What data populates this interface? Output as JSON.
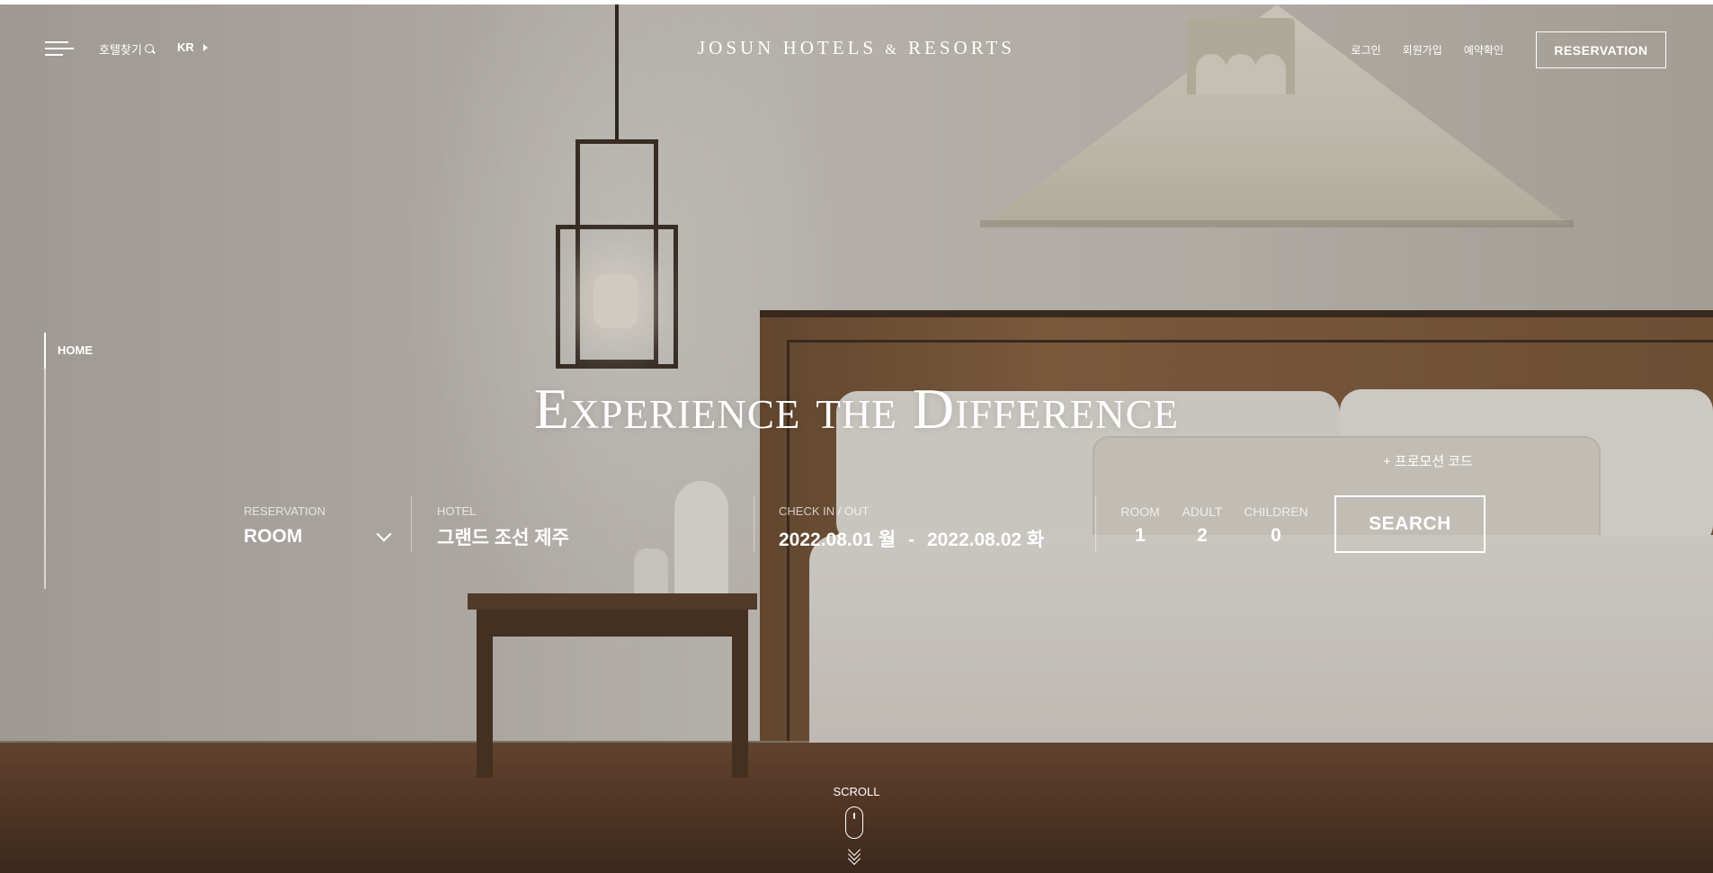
{
  "header": {
    "find_hotel_label": "호텔찾기",
    "language": "KR",
    "logo_main": "JOSUN HOTELS",
    "logo_amp": "&",
    "logo_tail": "RESORTS",
    "links": {
      "login": "로그인",
      "signup": "회원가입",
      "check_reservation": "예약확인"
    },
    "reservation_button": "RESERVATION"
  },
  "side_nav": {
    "active_item": "HOME"
  },
  "hero": {
    "title": "Experience the Difference"
  },
  "booking": {
    "promo_label": "+ 프로모션 코드",
    "reservation_type": {
      "label": "RESERVATION",
      "value": "ROOM"
    },
    "hotel": {
      "label": "HOTEL",
      "value": "그랜드 조선 제주"
    },
    "dates": {
      "label": "CHECK IN / OUT",
      "check_in": "2022.08.01 월",
      "separator": "-",
      "check_out": "2022.08.02 화"
    },
    "room": {
      "label": "ROOM",
      "value": "1"
    },
    "adult": {
      "label": "ADULT",
      "value": "2"
    },
    "children": {
      "label": "CHILDREN",
      "value": "0"
    },
    "search_button": "SEARCH"
  },
  "scroll": {
    "label": "SCROLL"
  },
  "icons": [
    "menu-icon",
    "search-icon",
    "caret-right-icon",
    "chevron-down-icon",
    "mouse-icon",
    "chevrons-down-icon"
  ],
  "colors": {
    "text": "#ffffff",
    "wood": "#7a573a",
    "wall": "#c9c4be"
  }
}
